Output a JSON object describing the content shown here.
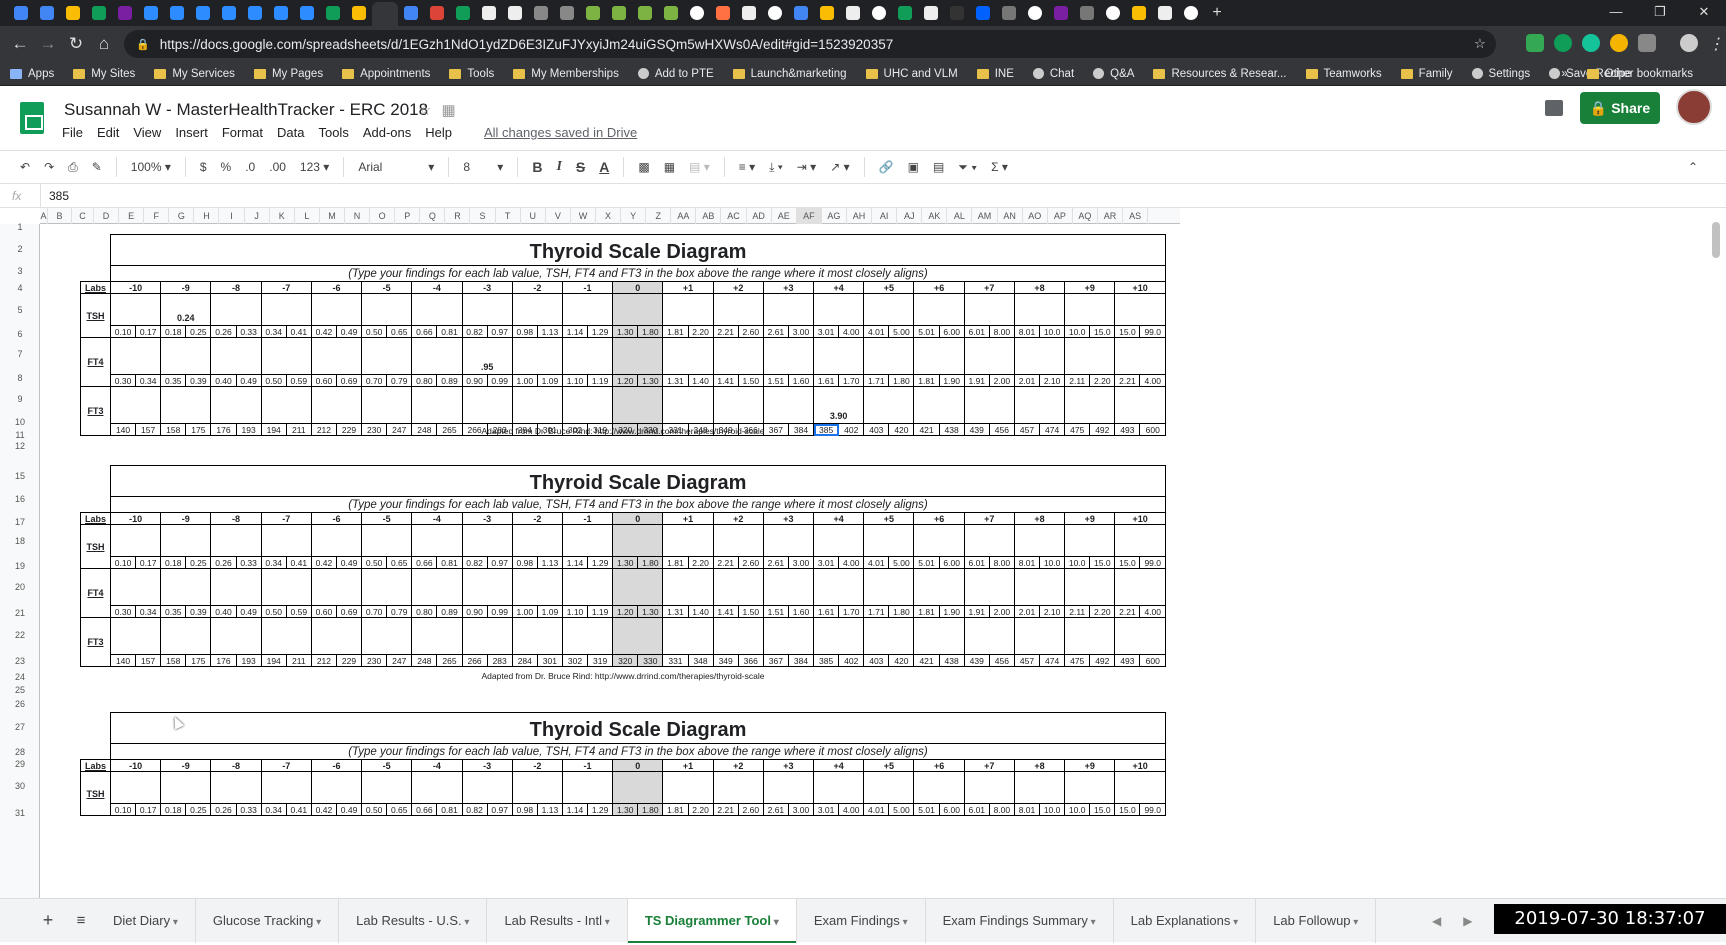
{
  "browser": {
    "url": "https://docs.google.com/spreadsheets/d/1EGzh1NdO1ydZD6E3IZuFJYxyiJm24uiGSQm5wHXWs0A/edit#gid=1523920357",
    "bookmarks": [
      "Apps",
      "My Sites",
      "My Services",
      "My Pages",
      "Appointments",
      "Tools",
      "My Memberships",
      "Add to PTE",
      "Launch&marketing",
      "UHC and VLM",
      "INE",
      "Chat",
      "Q&A",
      "Resources & Resear...",
      "Teamworks",
      "Family",
      "Settings",
      "Save Recipe"
    ],
    "other_bookmarks": "Other bookmarks"
  },
  "doc": {
    "title": "Susannah W - MasterHealthTracker - ERC 2018",
    "menu": [
      "File",
      "Edit",
      "View",
      "Insert",
      "Format",
      "Data",
      "Tools",
      "Add-ons",
      "Help"
    ],
    "saved_status": "All changes saved in Drive",
    "share_label": "Share"
  },
  "toolbar": {
    "zoom": "100%",
    "currency": "$",
    "percent": "%",
    "dec_dec": ".0",
    "dec_inc": ".00",
    "format": "123",
    "font": "Arial",
    "size": "8",
    "bold": "B",
    "italic": "I",
    "strike": "S",
    "color": "A"
  },
  "formula": {
    "fx": "fx",
    "value": "385"
  },
  "columns": [
    "A",
    "B",
    "C",
    "D",
    "E",
    "F",
    "G",
    "H",
    "I",
    "J",
    "K",
    "L",
    "M",
    "N",
    "O",
    "P",
    "Q",
    "R",
    "S",
    "T",
    "U",
    "V",
    "W",
    "X",
    "Y",
    "Z",
    "AA",
    "AB",
    "AC",
    "AD",
    "AE",
    "AF",
    "AG",
    "AH",
    "AI",
    "AJ",
    "AK",
    "AL",
    "AM",
    "AN",
    "AO",
    "AP",
    "AQ",
    "AR",
    "AS"
  ],
  "rows": [
    "1",
    "2",
    "3",
    "4",
    "5",
    "6",
    "7",
    "8",
    "9",
    "10",
    "11",
    "12",
    "15",
    "16",
    "17",
    "18",
    "19",
    "20",
    "21",
    "22",
    "23",
    "24",
    "25",
    "26",
    "27",
    "28",
    "29",
    "30",
    "31"
  ],
  "diagram": {
    "title": "Thyroid Scale Diagram",
    "subtitle": "(Type your findings for each lab value, TSH, FT4 and FT3 in the box above the range where it most closely aligns)",
    "labs_label": "Labs",
    "scale": [
      "-10",
      "-9",
      "-8",
      "-7",
      "-6",
      "-5",
      "-4",
      "-3",
      "-2",
      "-1",
      "0",
      "+1",
      "+2",
      "+3",
      "+4",
      "+5",
      "+6",
      "+7",
      "+8",
      "+9",
      "+10"
    ],
    "tsh_label": "TSH",
    "ft4_label": "FT4",
    "ft3_label": "FT3",
    "tsh_ranges": [
      "0.10",
      "0.17",
      "0.18",
      "0.25",
      "0.26",
      "0.33",
      "0.34",
      "0.41",
      "0.42",
      "0.49",
      "0.50",
      "0.65",
      "0.66",
      "0.81",
      "0.82",
      "0.97",
      "0.98",
      "1.13",
      "1.14",
      "1.29",
      "1.30",
      "1.80",
      "1.81",
      "2.20",
      "2.21",
      "2.60",
      "2.61",
      "3.00",
      "3.01",
      "4.00",
      "4.01",
      "5.00",
      "5.01",
      "6.00",
      "6.01",
      "8.00",
      "8.01",
      "10.0",
      "10.0",
      "15.0",
      "15.0",
      "99.0"
    ],
    "ft4_ranges": [
      "0.30",
      "0.34",
      "0.35",
      "0.39",
      "0.40",
      "0.49",
      "0.50",
      "0.59",
      "0.60",
      "0.69",
      "0.70",
      "0.79",
      "0.80",
      "0.89",
      "0.90",
      "0.99",
      "1.00",
      "1.09",
      "1.10",
      "1.19",
      "1.20",
      "1.30",
      "1.31",
      "1.40",
      "1.41",
      "1.50",
      "1.51",
      "1.60",
      "1.61",
      "1.70",
      "1.71",
      "1.80",
      "1.81",
      "1.90",
      "1.91",
      "2.00",
      "2.01",
      "2.10",
      "2.11",
      "2.20",
      "2.21",
      "4.00"
    ],
    "ft3_ranges": [
      "140",
      "157",
      "158",
      "175",
      "176",
      "193",
      "194",
      "211",
      "212",
      "229",
      "230",
      "247",
      "248",
      "265",
      "266",
      "283",
      "284",
      "301",
      "302",
      "319",
      "320",
      "330",
      "331",
      "348",
      "349",
      "366",
      "367",
      "384",
      "385",
      "402",
      "403",
      "420",
      "421",
      "438",
      "439",
      "456",
      "457",
      "474",
      "475",
      "492",
      "493",
      "600"
    ],
    "adapted": "Adapted from Dr. Bruce Rind:  http://www.drrind.com/therapies/thyroid-scale",
    "findings": {
      "tsh": "0.24",
      "ft4": ".95",
      "ft3": "3.90"
    }
  },
  "sheet_tabs": [
    "Diet Diary",
    "Glucose Tracking",
    "Lab Results - U.S.",
    "Lab Results - Intl",
    "TS Diagrammer Tool",
    "Exam Findings",
    "Exam Findings Summary",
    "Lab Explanations",
    "Lab Followup"
  ],
  "active_tab": "TS Diagrammer Tool",
  "timestamp": "2019-07-30 18:37:07",
  "colors": {
    "share": "#188038",
    "sheets_green": "#0f9d58",
    "selection": "#1a73e8",
    "zero_fill": "#d9d9d9"
  }
}
